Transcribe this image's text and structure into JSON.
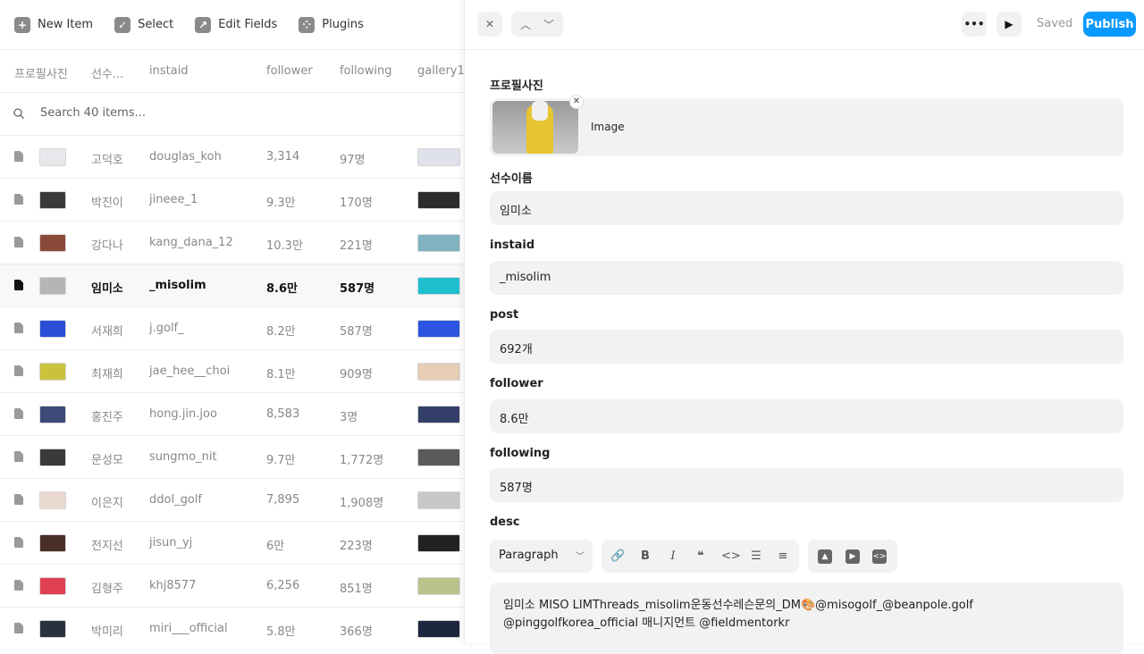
{
  "toolbar": {
    "new_item": "New Item",
    "select": "Select",
    "edit_fields": "Edit Fields",
    "plugins": "Plugins"
  },
  "columns": [
    "프로필사진",
    "선수...",
    "instaid",
    "follower",
    "following",
    "gallery1"
  ],
  "search": {
    "placeholder": "Search 40 items..."
  },
  "rows": [
    {
      "name": "고덕호",
      "instaid": "douglas_koh",
      "follower": "3,314",
      "following": "97명",
      "thumb_color": "#e8e8ec",
      "gal_color": "#dfe2ea"
    },
    {
      "name": "박진이",
      "instaid": "jineee_1",
      "follower": "9.3만",
      "following": "170명",
      "thumb_color": "#3a3a3a",
      "gal_color": "#2c2c2c"
    },
    {
      "name": "강다나",
      "instaid": "kang_dana_12",
      "follower": "10.3만",
      "following": "221명",
      "thumb_color": "#8a4a3a",
      "gal_color": "#7fb3c0"
    },
    {
      "name": "임미소",
      "instaid": "_misolim",
      "follower": "8.6만",
      "following": "587명",
      "thumb_color": "#b5b5b5",
      "gal_color": "#1ec0d0"
    },
    {
      "name": "서재희",
      "instaid": "j.golf_",
      "follower": "8.2만",
      "following": "587명",
      "thumb_color": "#2a4fd6",
      "gal_color": "#2b54e0"
    },
    {
      "name": "최재희",
      "instaid": "jae_hee__choi",
      "follower": "8.1만",
      "following": "909명",
      "thumb_color": "#c9c23a",
      "gal_color": "#e8cdb5"
    },
    {
      "name": "홍진주",
      "instaid": "hong.jin.joo",
      "follower": "8,583",
      "following": "3명",
      "thumb_color": "#3c4a78",
      "gal_color": "#34406a"
    },
    {
      "name": "문성모",
      "instaid": "sungmo_nit",
      "follower": "9.7만",
      "following": "1,772명",
      "thumb_color": "#3a3a3a",
      "gal_color": "#5a5a5a"
    },
    {
      "name": "이은지",
      "instaid": "ddol_golf",
      "follower": "7,895",
      "following": "1,908명",
      "thumb_color": "#ead9cf",
      "gal_color": "#c8c8c8"
    },
    {
      "name": "전지선",
      "instaid": "jisun_yj",
      "follower": "6만",
      "following": "223명",
      "thumb_color": "#4a2e28",
      "gal_color": "#222222"
    },
    {
      "name": "김형주",
      "instaid": "khj8577",
      "follower": "6,256",
      "following": "851명",
      "thumb_color": "#e04050",
      "gal_color": "#b9c48a"
    },
    {
      "name": "박미리",
      "instaid": "miri___official",
      "follower": "5.8만",
      "following": "366명",
      "thumb_color": "#2a3040",
      "gal_color": "#1d2740"
    }
  ],
  "detail": {
    "saved": "Saved",
    "publish": "Publish",
    "fields": {
      "profile_label": "프로필사진",
      "image_label": "Image",
      "name_label": "선수이름",
      "name_value": "임미소",
      "instaid_label": "instaid",
      "instaid_value": "_misolim",
      "post_label": "post",
      "post_value": "692개",
      "follower_label": "follower",
      "follower_value": "8.6만",
      "following_label": "following",
      "following_value": "587명",
      "desc_label": "desc"
    },
    "editor": {
      "paragraph": "Paragraph",
      "desc_text": "임미소 MISO LIMThreads_misolim운동선수레슨문의_DM🎨@misogolf_@beanpole.golf @pinggolfkorea_official 매니지먼트 @fieldmentorkr"
    }
  },
  "colors": {
    "accent": "#0a99ff"
  }
}
